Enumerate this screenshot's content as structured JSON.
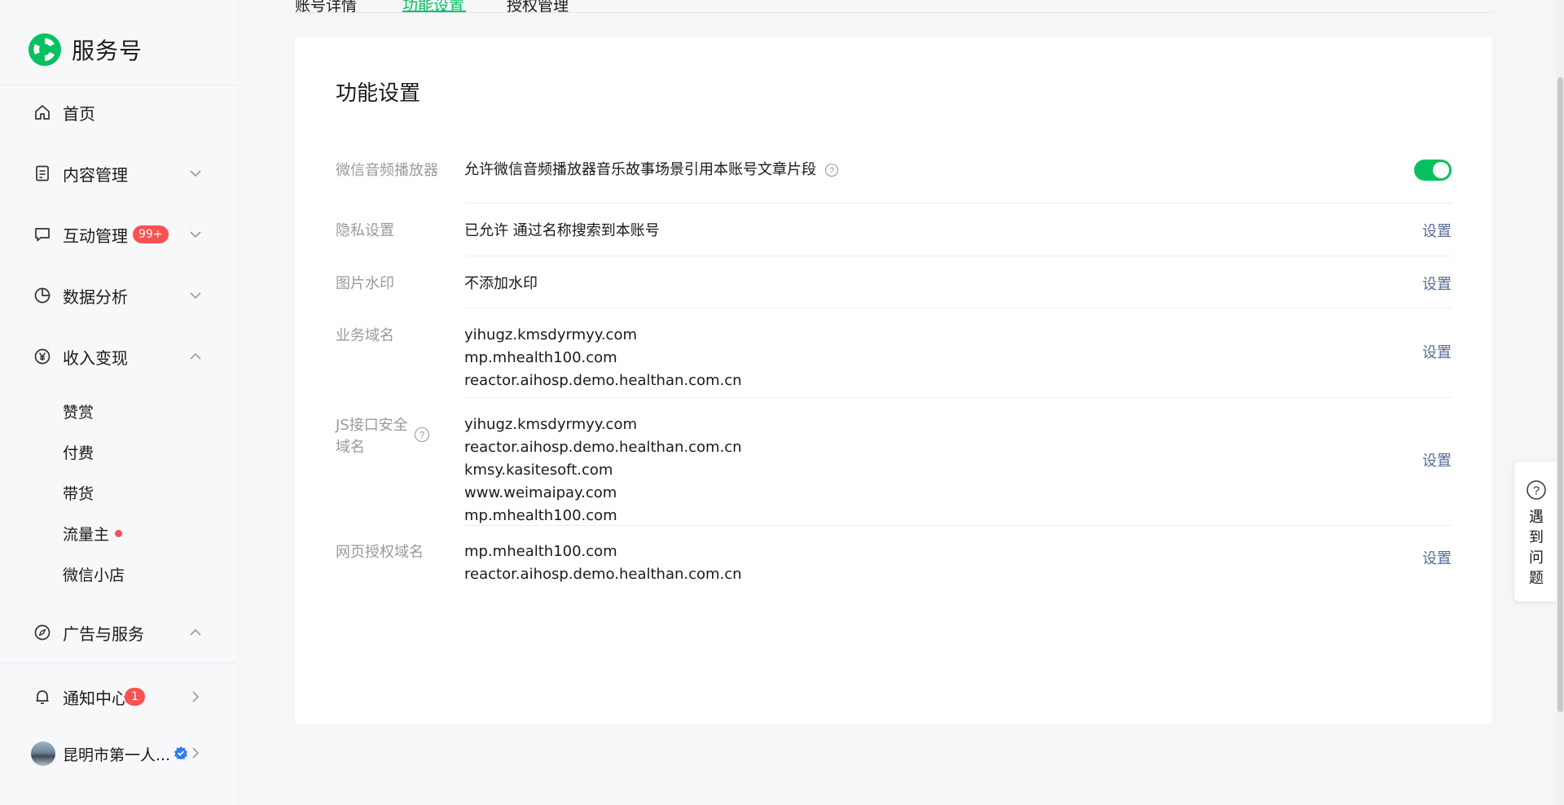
{
  "brand": {
    "name": "服务号",
    "logo_icon": "service-account-logo"
  },
  "sidebar": {
    "items": [
      {
        "label": "首页",
        "icon": "home-icon"
      },
      {
        "label": "内容管理",
        "icon": "document-icon",
        "chevron": "down"
      },
      {
        "label": "互动管理",
        "icon": "comment-icon",
        "chevron": "down",
        "badge": "99+"
      },
      {
        "label": "数据分析",
        "icon": "pie-chart-icon",
        "chevron": "down"
      },
      {
        "label": "收入变现",
        "icon": "yen-icon",
        "chevron": "up"
      },
      {
        "label": "广告与服务",
        "icon": "compass-icon",
        "chevron": "up"
      },
      {
        "label": "通知中心",
        "icon": "bell-icon",
        "chevron": "right",
        "badge": "1"
      }
    ],
    "sub_items": [
      {
        "label": "赞赏"
      },
      {
        "label": "付费"
      },
      {
        "label": "带货"
      },
      {
        "label": "流量主",
        "dot": true
      },
      {
        "label": "微信小店"
      }
    ],
    "account": {
      "name": "昆明市第一人...",
      "verified_icon": "verified-badge-icon"
    }
  },
  "tabs": [
    {
      "label": "账号详情"
    },
    {
      "label": "功能设置",
      "active": true
    },
    {
      "label": "授权管理"
    }
  ],
  "main": {
    "title": "功能设置",
    "rows": [
      {
        "label": "微信音频播放器",
        "values": [
          "允许微信音频播放器音乐故事场景引用本账号文章片段"
        ],
        "control": "toggle",
        "toggle_on": true,
        "help": true
      },
      {
        "label": "隐私设置",
        "values": [
          "已允许 通过名称搜索到本账号"
        ],
        "action": "设置"
      },
      {
        "label": "图片水印",
        "values": [
          "不添加水印"
        ],
        "action": "设置"
      },
      {
        "label": "业务域名",
        "values": [
          "yihugz.kmsdyrmyy.com",
          "mp.mhealth100.com",
          "reactor.aihosp.demo.healthan.com.cn"
        ],
        "action": "设置"
      },
      {
        "label": "JS接口安全域名",
        "values": [
          "yihugz.kmsdyrmyy.com",
          "reactor.aihosp.demo.healthan.com.cn",
          "kmsy.kasitesoft.com",
          "www.weimaipay.com",
          "mp.mhealth100.com"
        ],
        "action": "设置",
        "label_help": true
      },
      {
        "label": "网页授权域名",
        "values": [
          "mp.mhealth100.com",
          "reactor.aihosp.demo.healthan.com.cn"
        ],
        "action": "设置"
      }
    ]
  },
  "float_help": {
    "label": "遇到问题",
    "icon": "question-circle-icon"
  },
  "colors": {
    "accent": "#07c160",
    "link": "#576b95",
    "badge": "#fa5151",
    "label": "#9a9a9a"
  }
}
